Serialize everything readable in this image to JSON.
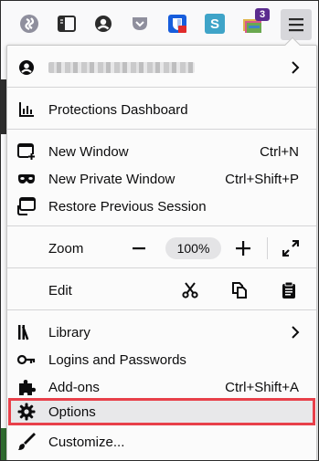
{
  "toolbar": {
    "icons": [
      "sync-icon",
      "sidebar-icon",
      "account-icon",
      "pocket-icon",
      "bitwarden-icon",
      "s-extension-icon",
      "folders-extension-icon",
      "hamburger-menu-icon"
    ],
    "s_extension_letter": "S",
    "folders_badge": "3"
  },
  "menu": {
    "account": {
      "blurred": true
    },
    "protections_dashboard": "Protections Dashboard",
    "new_window": {
      "label": "New Window",
      "shortcut": "Ctrl+N"
    },
    "new_private_window": {
      "label": "New Private Window",
      "shortcut": "Ctrl+Shift+P"
    },
    "restore_session": {
      "label": "Restore Previous Session"
    },
    "zoom": {
      "label": "Zoom",
      "minus": "−",
      "value": "100%",
      "plus": "+"
    },
    "edit": {
      "label": "Edit"
    },
    "library": {
      "label": "Library"
    },
    "logins": {
      "label": "Logins and Passwords"
    },
    "addons": {
      "label": "Add-ons",
      "shortcut": "Ctrl+Shift+A"
    },
    "options": {
      "label": "Options",
      "highlighted": true
    },
    "customize": {
      "label": "Customize..."
    }
  },
  "colors": {
    "highlight_border": "#e8404a",
    "menu_button_bg": "#d7d7db",
    "badge_bg": "#5b2c8f",
    "s_icon_bg": "#3fa4c8",
    "bitwarden_blue": "#175ddc"
  }
}
